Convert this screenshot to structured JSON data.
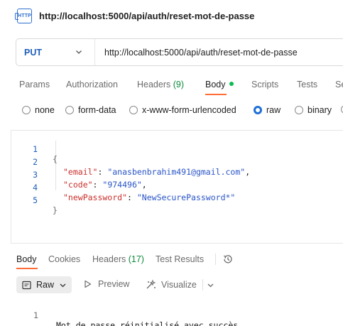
{
  "request": {
    "title": "http://localhost:5000/api/auth/reset-mot-de-passe",
    "method": "PUT",
    "url": "http://localhost:5000/api/auth/reset-mot-de-passe"
  },
  "tabs": {
    "params": "Params",
    "authorization": "Authorization",
    "headers": "Headers",
    "headers_count": "(9)",
    "body": "Body",
    "scripts": "Scripts",
    "tests": "Tests",
    "settings_partial": "Se"
  },
  "body_types": {
    "none": "none",
    "form_data": "form-data",
    "urlencoded": "x-www-form-urlencoded",
    "raw": "raw",
    "binary": "binary",
    "selected": "raw"
  },
  "editor": {
    "lines": [
      {
        "n": "1",
        "open": "{"
      },
      {
        "n": "2",
        "key": "\"email\"",
        "value": "\"anasbenbrahim491@gmail.com\"",
        "trail": ","
      },
      {
        "n": "3",
        "key": "\"code\"",
        "value": "\"974496\"",
        "trail": ","
      },
      {
        "n": "4",
        "key": "\"newPassword\"",
        "value": "\"NewSecurePassword*\"",
        "trail": ""
      },
      {
        "n": "5",
        "close": "}"
      }
    ]
  },
  "response": {
    "tabs": {
      "body": "Body",
      "cookies": "Cookies",
      "headers": "Headers",
      "headers_count": "(17)",
      "test_results": "Test Results"
    },
    "format": "Raw",
    "preview": "Preview",
    "visualize": "Visualize",
    "line_number": "1",
    "message": "Mot de passe réinitialisé avec succès."
  },
  "colors": {
    "accent": "#ff6c37",
    "method": "#1f5fb8",
    "count": "#0b8a3a",
    "body_dot": "#0cbb52"
  }
}
